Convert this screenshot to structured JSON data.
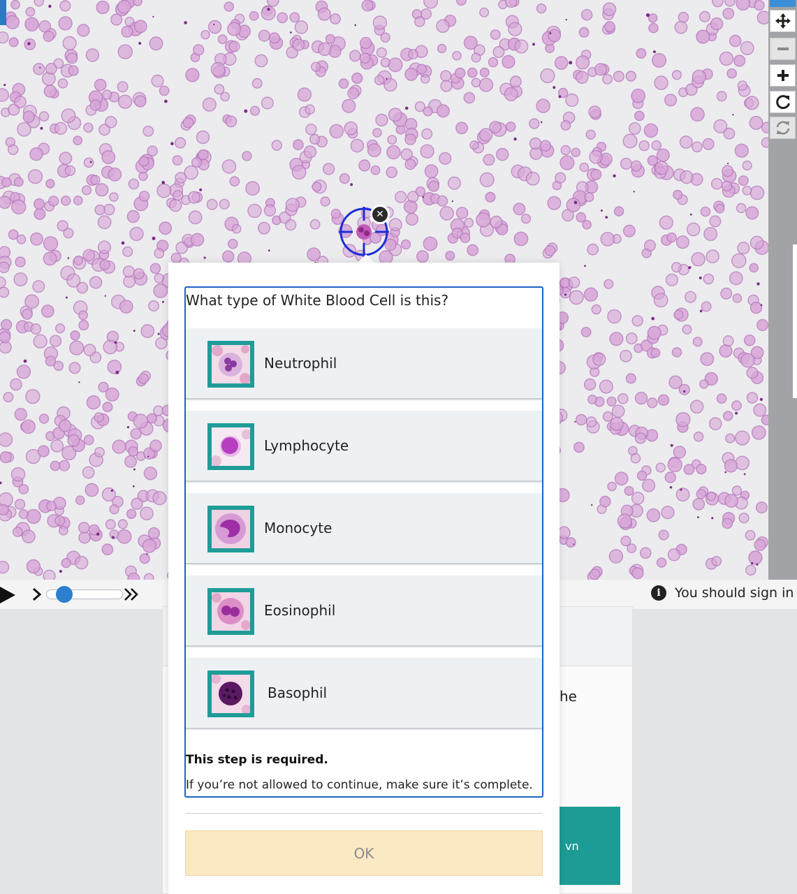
{
  "viewer": {
    "slide_colors": {
      "background": "#ececee",
      "cell": "#d8a8d8",
      "cell_rim": "#b070b8"
    },
    "toolbar": [
      {
        "name": "pan-icon",
        "state": "enabled"
      },
      {
        "name": "zoom-out-icon",
        "state": "disabled"
      },
      {
        "name": "zoom-in-icon",
        "state": "enabled"
      },
      {
        "name": "rotate-icon",
        "state": "enabled"
      },
      {
        "name": "reset-view-icon",
        "state": "disabled"
      }
    ]
  },
  "controls": {
    "play_icon": "play-icon",
    "step_icon": "chevron-right-icon",
    "fast_forward_icon": "double-chevron-right-icon",
    "speed_level": 0.1,
    "notice": "You should sign in"
  },
  "background_card": {
    "text_fragment": "he",
    "button_fragment": "vn"
  },
  "popup": {
    "question": "What type of White Blood Cell is this?",
    "options": [
      {
        "label": "Neutrophil",
        "icon": "neutrophil-thumbnail"
      },
      {
        "label": "Lymphocyte",
        "icon": "lymphocyte-thumbnail"
      },
      {
        "label": "Monocyte",
        "icon": "monocyte-thumbnail"
      },
      {
        "label": "Eosinophil",
        "icon": "eosinophil-thumbnail"
      },
      {
        "label": "Basophil",
        "icon": "basophil-thumbnail"
      }
    ],
    "required_title": "This step is required.",
    "required_note": "If you’re not allowed to continue, make sure it’s complete.",
    "ok_label": "OK",
    "colors": {
      "border": "#1d63c4",
      "thumb_frame": "#1f9c98",
      "ok_bg": "#fbe9c3"
    }
  }
}
